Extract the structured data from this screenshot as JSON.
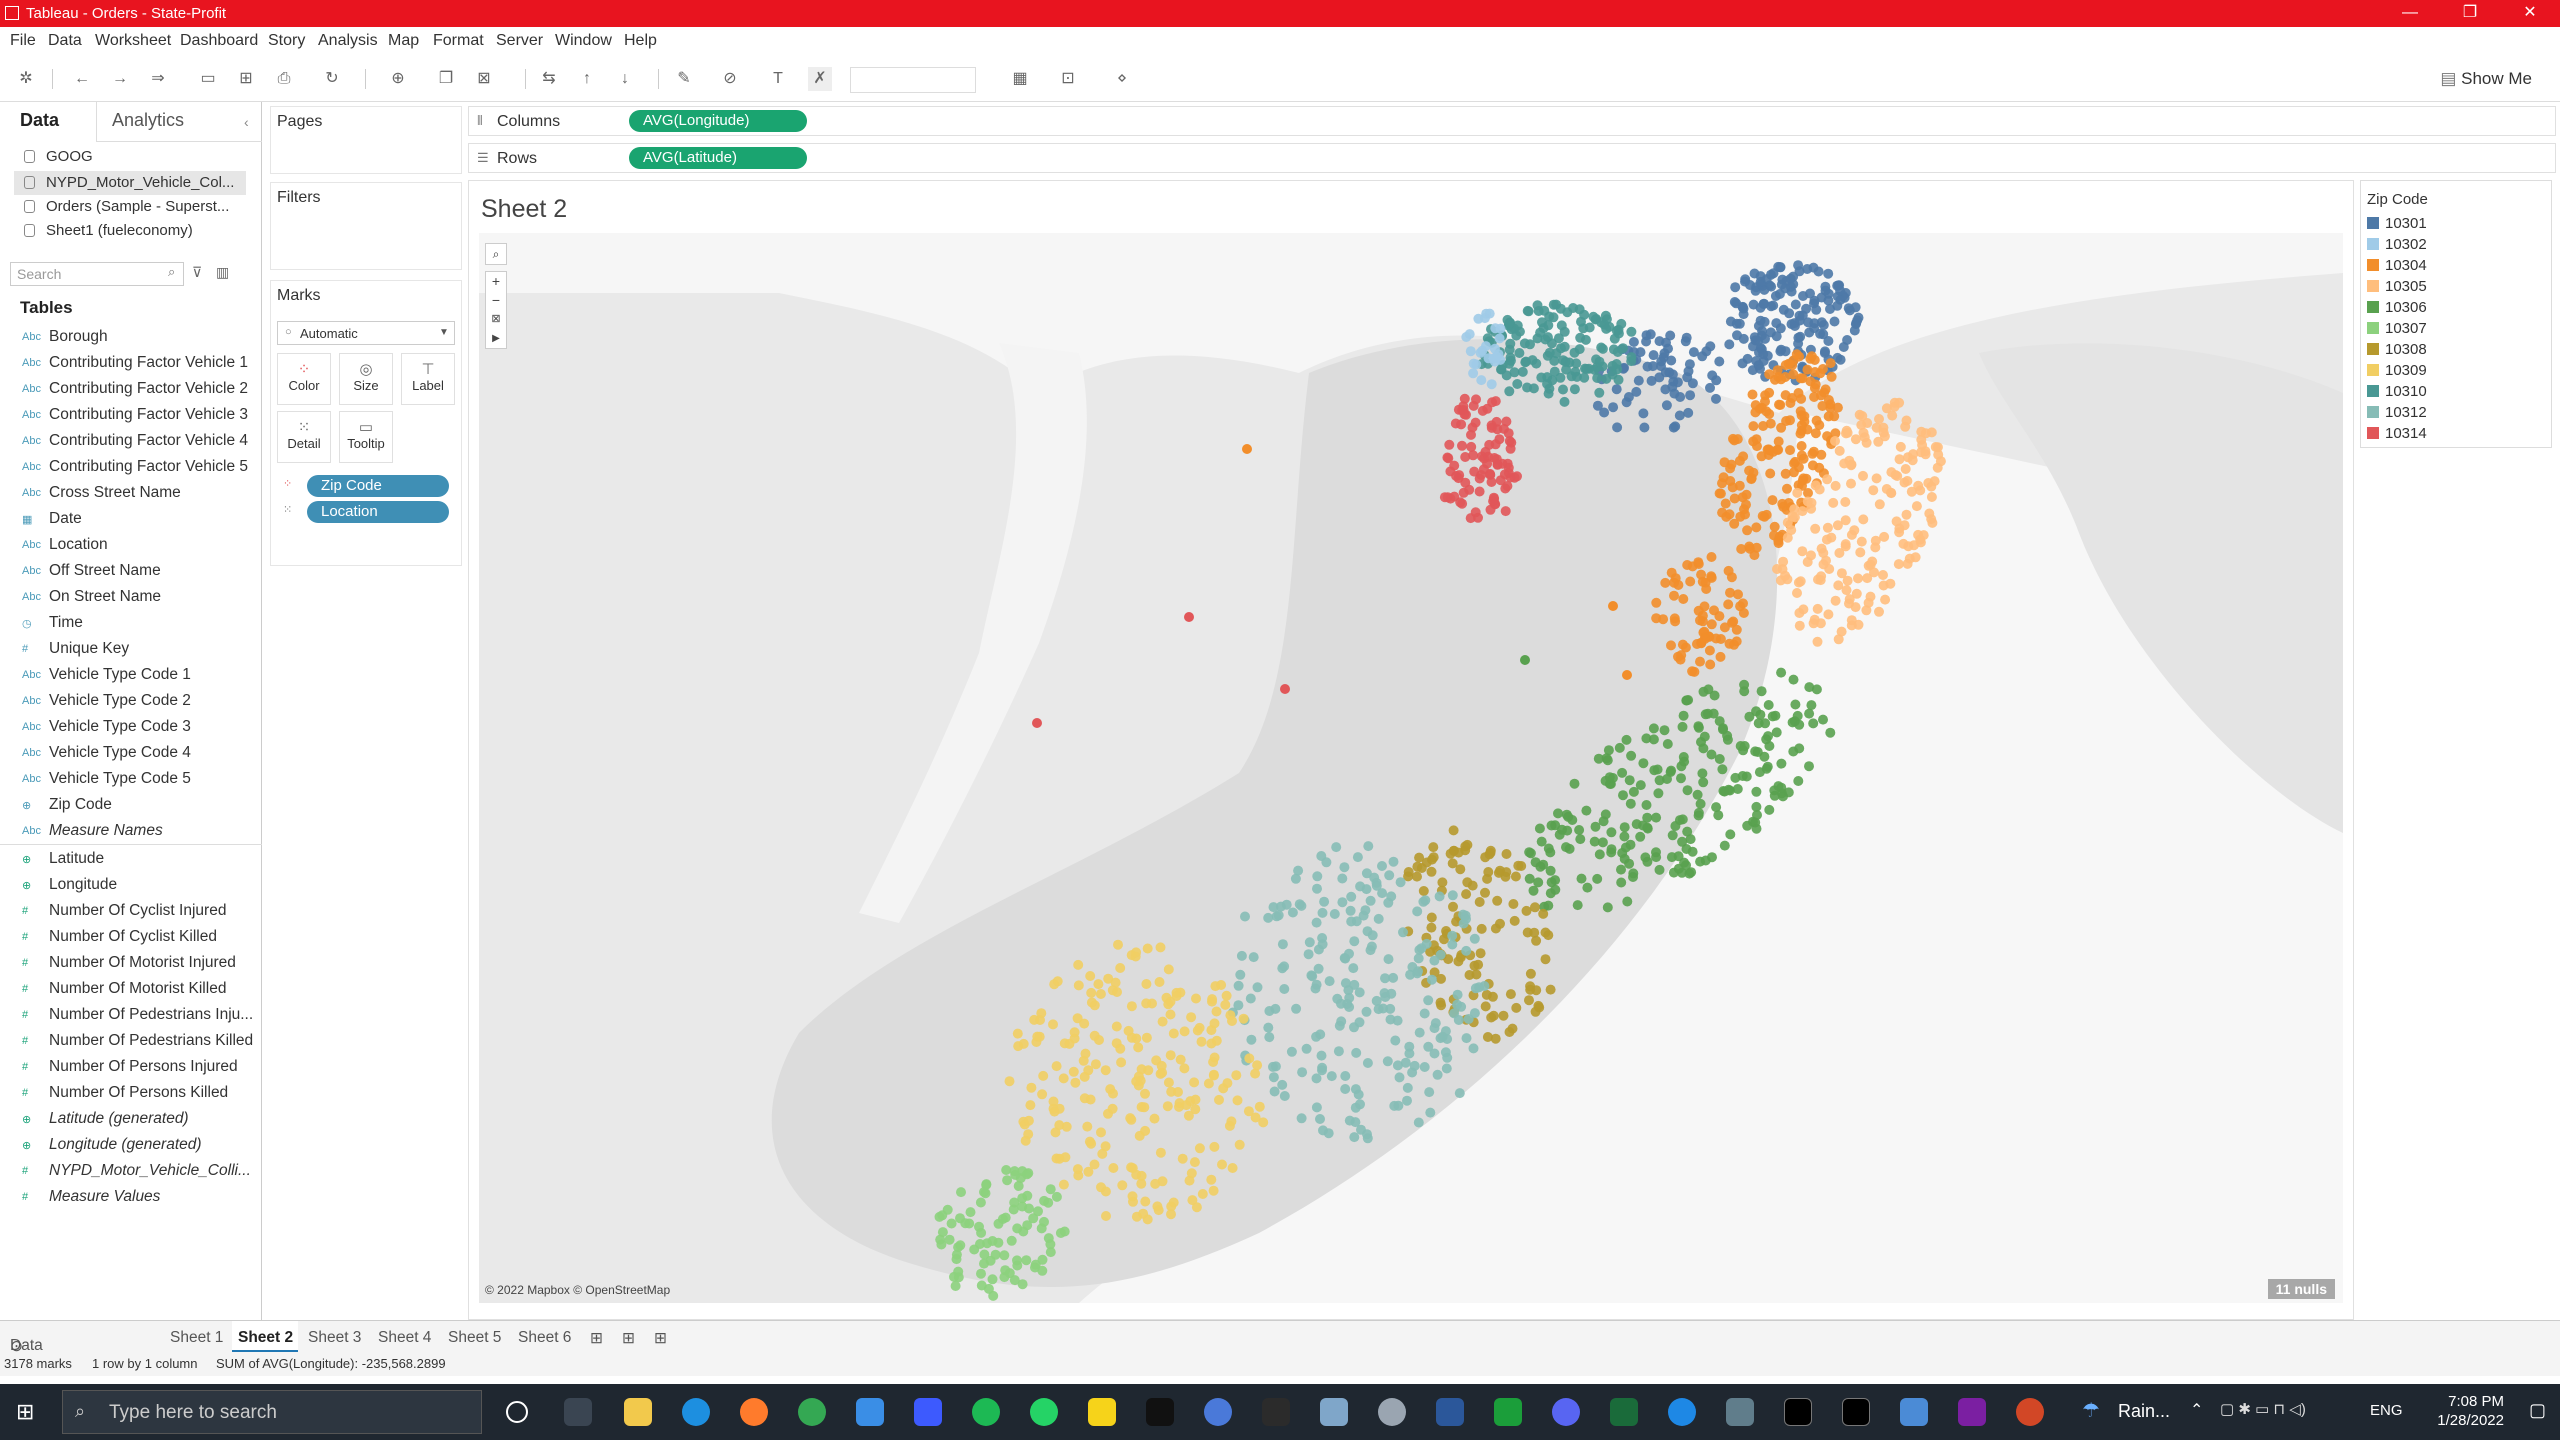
{
  "window": {
    "title": "Tableau - Orders - State-Profit",
    "controls": [
      "—",
      "❐",
      "✕"
    ]
  },
  "menu": [
    "File",
    "Data",
    "Worksheet",
    "Dashboard",
    "Story",
    "Analysis",
    "Map",
    "Format",
    "Server",
    "Window",
    "Help"
  ],
  "toolbar": {
    "show_me": "Show Me"
  },
  "data_pane": {
    "tabs": [
      "Data",
      "Analytics"
    ],
    "datasources": [
      "GOOG",
      "NYPD_Motor_Vehicle_Col...",
      "Orders (Sample - Superst...",
      "Sheet1 (fueleconomy)"
    ],
    "search_placeholder": "Search",
    "tables_label": "Tables",
    "dimensions": [
      {
        "icon": "Abc",
        "label": "Borough"
      },
      {
        "icon": "Abc",
        "label": "Contributing Factor Vehicle 1"
      },
      {
        "icon": "Abc",
        "label": "Contributing Factor Vehicle 2"
      },
      {
        "icon": "Abc",
        "label": "Contributing Factor Vehicle 3"
      },
      {
        "icon": "Abc",
        "label": "Contributing Factor Vehicle 4"
      },
      {
        "icon": "Abc",
        "label": "Contributing Factor Vehicle 5"
      },
      {
        "icon": "Abc",
        "label": "Cross Street Name"
      },
      {
        "icon": "▦",
        "label": "Date"
      },
      {
        "icon": "Abc",
        "label": "Location"
      },
      {
        "icon": "Abc",
        "label": "Off Street Name"
      },
      {
        "icon": "Abc",
        "label": "On Street Name"
      },
      {
        "icon": "◷",
        "label": "Time"
      },
      {
        "icon": "#",
        "label": "Unique Key"
      },
      {
        "icon": "Abc",
        "label": "Vehicle Type Code 1"
      },
      {
        "icon": "Abc",
        "label": "Vehicle Type Code 2"
      },
      {
        "icon": "Abc",
        "label": "Vehicle Type Code 3"
      },
      {
        "icon": "Abc",
        "label": "Vehicle Type Code 4"
      },
      {
        "icon": "Abc",
        "label": "Vehicle Type Code 5"
      },
      {
        "icon": "⊕",
        "label": "Zip Code"
      },
      {
        "icon": "Abc",
        "label": "Measure Names"
      }
    ],
    "measures": [
      {
        "icon": "⊕",
        "label": "Latitude"
      },
      {
        "icon": "⊕",
        "label": "Longitude"
      },
      {
        "icon": "#",
        "label": "Number Of Cyclist Injured"
      },
      {
        "icon": "#",
        "label": "Number Of Cyclist Killed"
      },
      {
        "icon": "#",
        "label": "Number Of Motorist Injured"
      },
      {
        "icon": "#",
        "label": "Number Of Motorist Killed"
      },
      {
        "icon": "#",
        "label": "Number Of Pedestrians Inju..."
      },
      {
        "icon": "#",
        "label": "Number Of Pedestrians Killed"
      },
      {
        "icon": "#",
        "label": "Number Of Persons Injured"
      },
      {
        "icon": "#",
        "label": "Number Of Persons Killed"
      },
      {
        "icon": "⊕",
        "label": "Latitude (generated)"
      },
      {
        "icon": "⊕",
        "label": "Longitude (generated)"
      },
      {
        "icon": "#",
        "label": "NYPD_Motor_Vehicle_Colli..."
      },
      {
        "icon": "#",
        "label": "Measure Values"
      }
    ]
  },
  "cards": {
    "pages": "Pages",
    "filters": "Filters",
    "marks": "Marks",
    "mark_type": "Automatic",
    "mark_buttons": [
      "Color",
      "Size",
      "Label",
      "Detail",
      "Tooltip"
    ],
    "mark_pills": [
      "Zip Code",
      "Location"
    ]
  },
  "shelves": {
    "columns_label": "Columns",
    "columns_pill": "AVG(Longitude)",
    "rows_label": "Rows",
    "rows_pill": "AVG(Latitude)"
  },
  "view": {
    "title": "Sheet 2",
    "attribution": "© 2022 Mapbox © OpenStreetMap",
    "nulls": "11 nulls"
  },
  "legend": {
    "title": "Zip Code",
    "items": [
      {
        "label": "10301",
        "color": "#4e79a7"
      },
      {
        "label": "10302",
        "color": "#a0cbe8"
      },
      {
        "label": "10304",
        "color": "#f28e2b"
      },
      {
        "label": "10305",
        "color": "#ffbe7d"
      },
      {
        "label": "10306",
        "color": "#59a14f"
      },
      {
        "label": "10307",
        "color": "#8cd17d"
      },
      {
        "label": "10308",
        "color": "#b6992d"
      },
      {
        "label": "10309",
        "color": "#f1ce63"
      },
      {
        "label": "10310",
        "color": "#499894"
      },
      {
        "label": "10312",
        "color": "#86bcb6"
      },
      {
        "label": "10314",
        "color": "#e15759"
      }
    ]
  },
  "sheet_tabs": [
    "Data Source",
    "Sheet 1",
    "Sheet 2",
    "Sheet 3",
    "Sheet 4",
    "Sheet 5",
    "Sheet 6"
  ],
  "status": {
    "marks": "3178 marks",
    "rows_cols": "1 row by 1 column",
    "sum": "SUM of AVG(Longitude): -235,568.2899"
  },
  "taskbar": {
    "search_placeholder": "Type here to search",
    "weather": "Rain...",
    "lang": "ENG",
    "time": "7:08 PM",
    "date": "1/28/2022"
  }
}
